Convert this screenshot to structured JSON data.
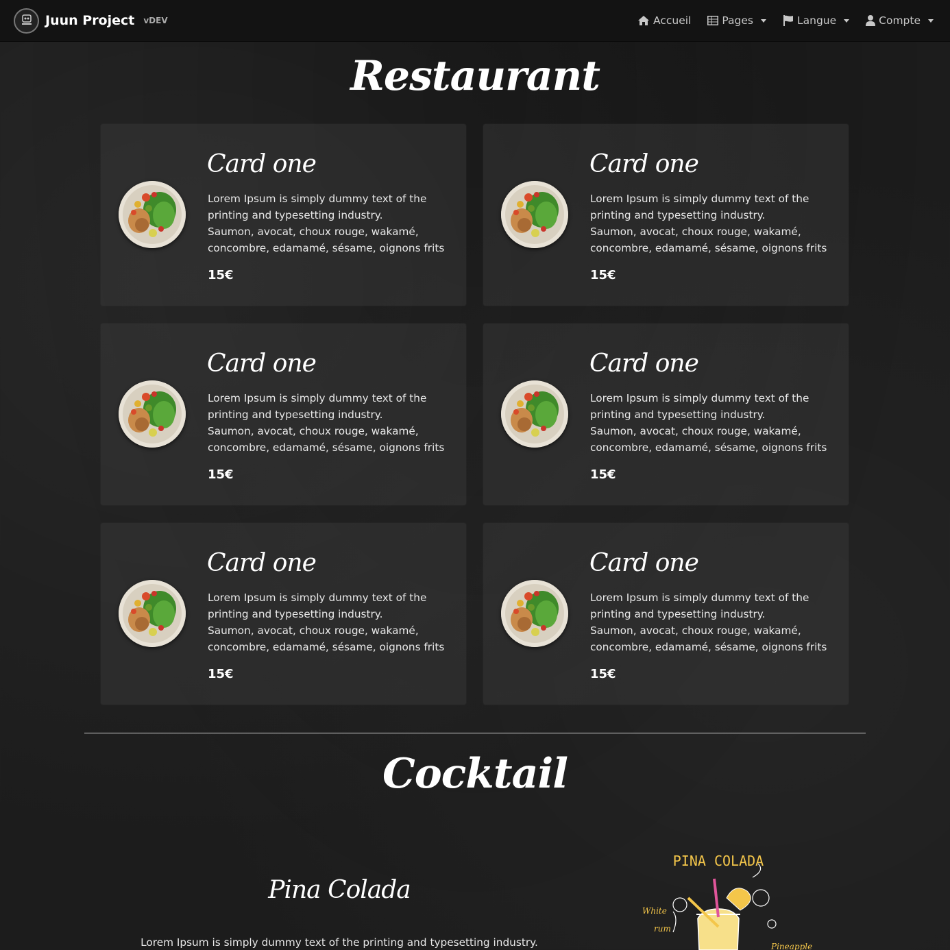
{
  "navbar": {
    "brand": "Juun Project",
    "version": "vDEV",
    "items": [
      {
        "label": "Accueil",
        "icon": "home-icon",
        "dropdown": false
      },
      {
        "label": "Pages",
        "icon": "table-icon",
        "dropdown": true
      },
      {
        "label": "Langue",
        "icon": "flag-icon",
        "dropdown": true
      },
      {
        "label": "Compte",
        "icon": "user-icon",
        "dropdown": true
      }
    ]
  },
  "restaurant": {
    "title": "Restaurant",
    "cards": [
      {
        "title": "Card one",
        "desc1": "Lorem Ipsum is simply dummy text of the printing and typesetting industry.",
        "desc2": "Saumon, avocat, choux rouge, wakamé, concombre, edamamé, sésame, oignons frits",
        "price": "15€"
      },
      {
        "title": "Card one",
        "desc1": "Lorem Ipsum is simply dummy text of the printing and typesetting industry.",
        "desc2": "Saumon, avocat, choux rouge, wakamé, concombre, edamamé, sésame, oignons frits",
        "price": "15€"
      },
      {
        "title": "Card one",
        "desc1": "Lorem Ipsum is simply dummy text of the printing and typesetting industry.",
        "desc2": "Saumon, avocat, choux rouge, wakamé, concombre, edamamé, sésame, oignons frits",
        "price": "15€"
      },
      {
        "title": "Card one",
        "desc1": "Lorem Ipsum is simply dummy text of the printing and typesetting industry.",
        "desc2": "Saumon, avocat, choux rouge, wakamé, concombre, edamamé, sésame, oignons frits",
        "price": "15€"
      },
      {
        "title": "Card one",
        "desc1": "Lorem Ipsum is simply dummy text of the printing and typesetting industry.",
        "desc2": "Saumon, avocat, choux rouge, wakamé, concombre, edamamé, sésame, oignons frits",
        "price": "15€"
      },
      {
        "title": "Card one",
        "desc1": "Lorem Ipsum is simply dummy text of the printing and typesetting industry.",
        "desc2": "Saumon, avocat, choux rouge, wakamé, concombre, edamamé, sésame, oignons frits",
        "price": "15€"
      }
    ]
  },
  "cocktail": {
    "title": "Cocktail",
    "name": "Pina Colada",
    "desc": "Lorem Ipsum is simply dummy text of the printing and typesetting industry.",
    "illustration": {
      "title": "PINA COLADA",
      "note_left_1": "White",
      "note_left_2": "rum",
      "note_right": "Pineapple"
    }
  },
  "colors": {
    "background": "#1c1c1c",
    "navbar": "#131313",
    "card": "#3c3c3c",
    "accent_yellow": "#f4c64a"
  }
}
